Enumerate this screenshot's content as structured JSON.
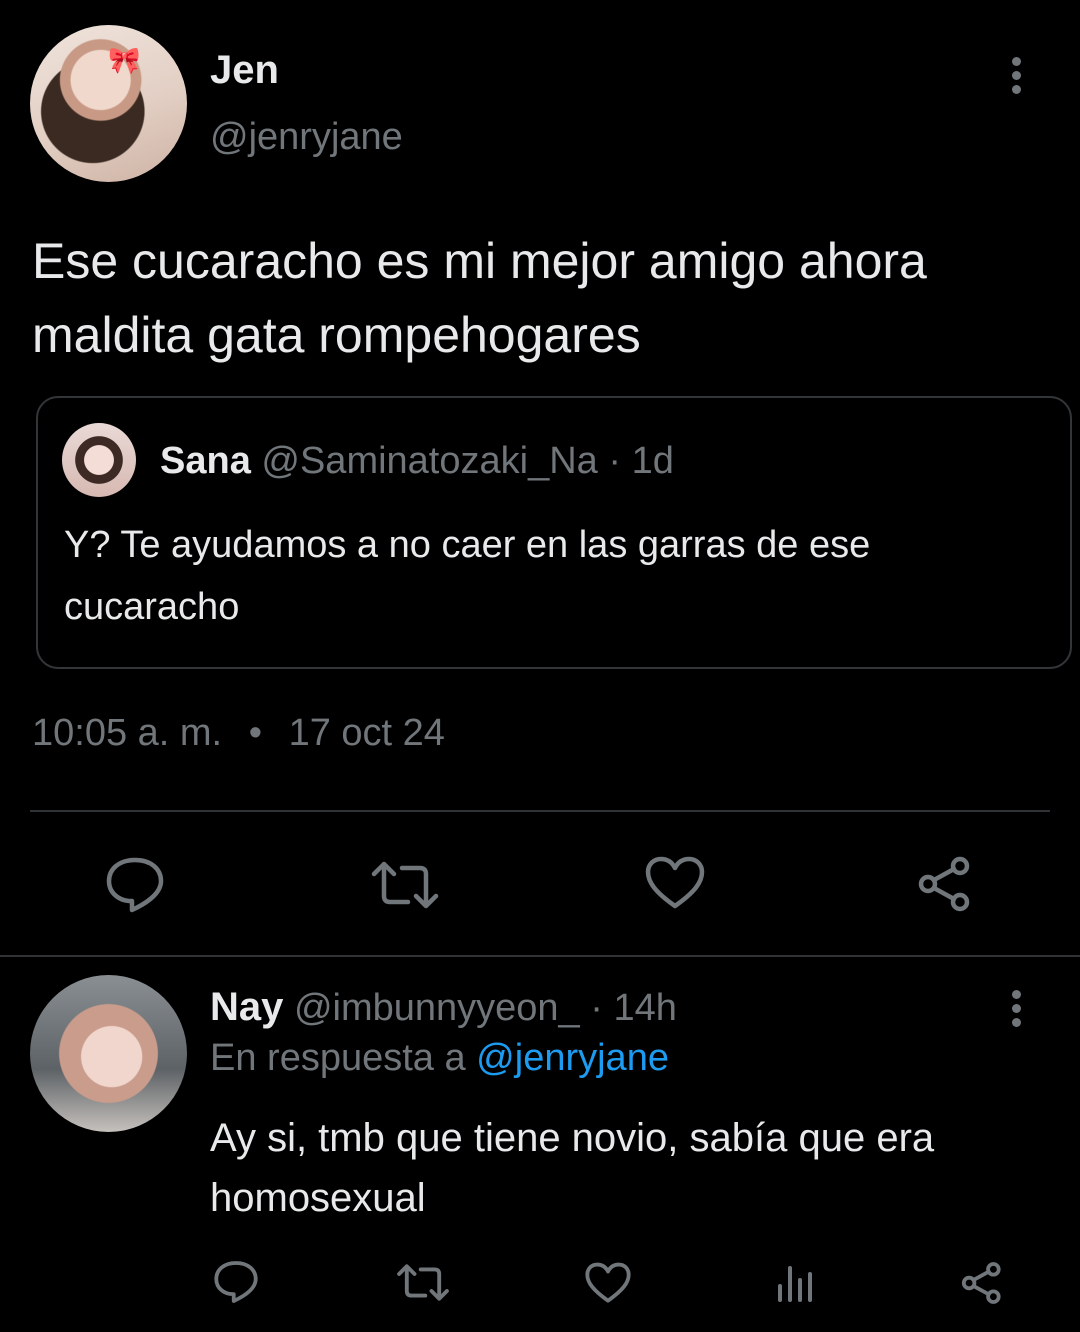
{
  "tweet": {
    "author_name": "Jen",
    "author_handle": "@jenryjane",
    "text_line1": "Ese cucaracho es mi mejor amigo ahora",
    "text_line2": "maldita gata rompehogares",
    "quoted": {
      "author_name": "Sana",
      "author_handle": "@Saminatozaki_Na",
      "separator": "·",
      "time": "1d",
      "text_line1": "Y? Te ayudamos a no caer en las garras de ese",
      "text_line2": "cucaracho"
    },
    "time": "10:05 a. m.",
    "dot": "•",
    "date": "17 oct 24"
  },
  "reply": {
    "author_name": "Nay",
    "author_handle": "@imbunnyyeon_",
    "separator": "·",
    "time": "14h",
    "reply_prefix": "En respuesta a",
    "reply_to": "@jenryjane",
    "text_line1": "Ay si, tmb que tiene novio, sabía que era",
    "text_line2": "homosexual"
  },
  "icons": {
    "reply": "reply-icon",
    "retweet": "retweet-icon",
    "like": "heart-icon",
    "share": "share-icon",
    "views": "views-icon",
    "more": "more-options-icon"
  },
  "colors": {
    "background": "#000000",
    "text": "#e7e9ea",
    "muted": "#71767b",
    "link": "#1d9bf0",
    "border": "#2f3336"
  }
}
